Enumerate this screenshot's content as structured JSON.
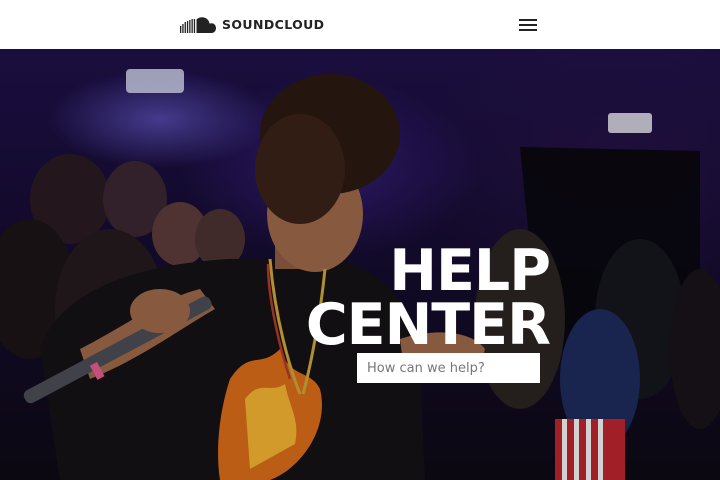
{
  "header": {
    "brand": "SOUNDCLOUD",
    "logo_icon": "soundcloud-cloud-icon",
    "menu_icon": "hamburger-menu-icon"
  },
  "hero": {
    "title_line1": "HELP",
    "title_line2": "CENTER",
    "search_placeholder": "How can we help?"
  },
  "colors": {
    "header_bg": "#ffffff",
    "brand_text": "#222222",
    "hero_bg": "#160c33",
    "title": "#ffffff"
  }
}
